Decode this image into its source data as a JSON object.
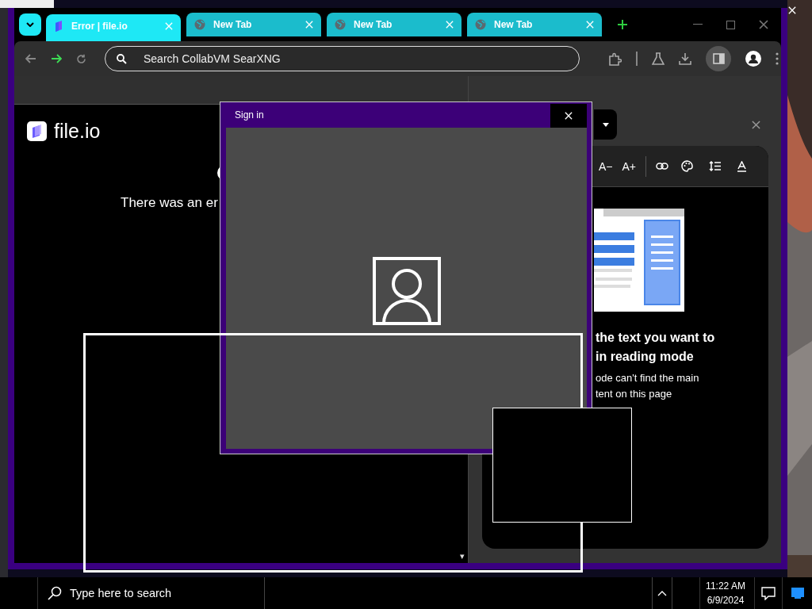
{
  "browser": {
    "tabs": [
      {
        "title": "Error | file.io",
        "selected": true
      },
      {
        "title": "New Tab",
        "selected": false
      },
      {
        "title": "New Tab",
        "selected": false
      },
      {
        "title": "New Tab",
        "selected": false
      }
    ],
    "address_bar": {
      "placeholder": "Search CollabVM SearXNG"
    }
  },
  "page": {
    "logo": "file.io",
    "error": "There was an er",
    "scroll_arrow": "▾"
  },
  "reading_panel": {
    "toolbar": [
      "A−",
      "A+"
    ],
    "heading": [
      "the text you want to",
      "in reading mode"
    ],
    "body": [
      "ode can't find the main",
      "tent on this page"
    ]
  },
  "dialog": {
    "title": "Sign in"
  },
  "taskbar": {
    "search_placeholder": "Type here to search",
    "time": "11:22 AM",
    "date": "6/9/2024"
  }
}
